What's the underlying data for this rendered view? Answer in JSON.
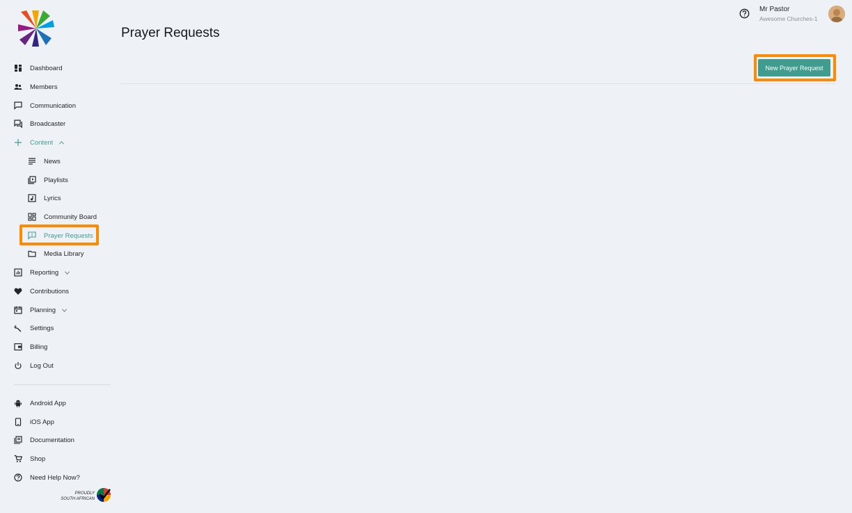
{
  "header": {
    "page_title": "Prayer Requests",
    "user_name": "Mr Pastor",
    "user_org": "Awesome Churches-1"
  },
  "toolbar": {
    "new_label": "New Prayer Request"
  },
  "sidebar": {
    "items": [
      {
        "label": "Dashboard",
        "icon": "dashboard-icon"
      },
      {
        "label": "Members",
        "icon": "people-icon"
      },
      {
        "label": "Communication",
        "icon": "chat-bubble-icon"
      },
      {
        "label": "Broadcaster",
        "icon": "broadcast-icon"
      },
      {
        "label": "Content",
        "icon": "plus-icon",
        "expanded": true
      },
      {
        "label": "News",
        "icon": "news-icon"
      },
      {
        "label": "Playlists",
        "icon": "playlist-icon"
      },
      {
        "label": "Lyrics",
        "icon": "music-note-icon"
      },
      {
        "label": "Community Board",
        "icon": "board-icon"
      },
      {
        "label": "Prayer Requests",
        "icon": "prayer-bubble-icon",
        "active": true
      },
      {
        "label": "Media Library",
        "icon": "folder-icon"
      },
      {
        "label": "Reporting",
        "icon": "chart-icon"
      },
      {
        "label": "Contributions",
        "icon": "heart-icon"
      },
      {
        "label": "Planning",
        "icon": "calendar-icon"
      },
      {
        "label": "Settings",
        "icon": "wrench-icon"
      },
      {
        "label": "Billing",
        "icon": "wallet-icon"
      },
      {
        "label": "Log Out",
        "icon": "power-icon"
      }
    ],
    "footer_items": [
      {
        "label": "Android App",
        "icon": "android-icon"
      },
      {
        "label": "iOS App",
        "icon": "phone-icon"
      },
      {
        "label": "Documentation",
        "icon": "docs-icon"
      },
      {
        "label": "Shop",
        "icon": "cart-icon"
      },
      {
        "label": "Need Help Now?",
        "icon": "help-icon"
      }
    ],
    "badge_line1": "PROUDLY",
    "badge_line2": "SOUTH AFRICAN"
  },
  "colors": {
    "accent": "#3f9c8e",
    "highlight": "#ff8a00",
    "background": "#eef2f7"
  }
}
